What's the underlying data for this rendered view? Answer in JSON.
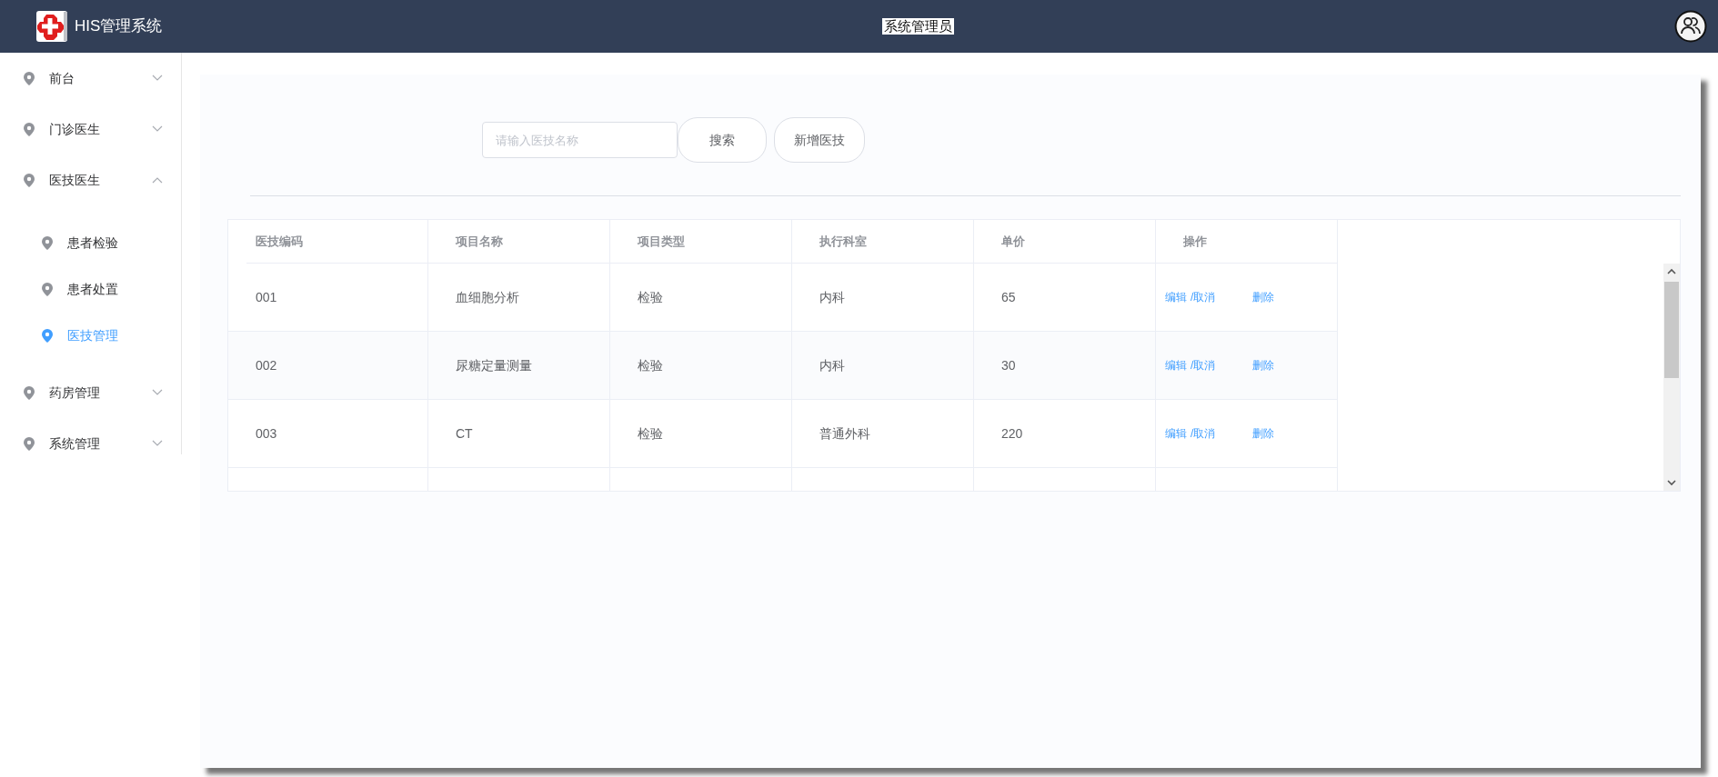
{
  "header": {
    "title": "HIS管理系统",
    "user": "系统管理员"
  },
  "sidebar": {
    "items": [
      {
        "label": "前台",
        "expanded": false
      },
      {
        "label": "门诊医生",
        "expanded": false
      },
      {
        "label": "医技医生",
        "expanded": true,
        "children": [
          {
            "label": "患者检验",
            "selected": false
          },
          {
            "label": "患者处置",
            "selected": false
          },
          {
            "label": "医技管理",
            "selected": true
          }
        ]
      },
      {
        "label": "药房管理",
        "expanded": false
      },
      {
        "label": "系统管理",
        "expanded": false
      }
    ]
  },
  "search": {
    "placeholder": "请输入医技名称"
  },
  "buttons": [
    "搜索",
    "新增医技"
  ],
  "table": {
    "columns": [
      "医技编码",
      "项目名称",
      "项目类型",
      "执行科室",
      "单价",
      "操作"
    ],
    "rows": [
      {
        "cells": [
          "001",
          "血细胞分析",
          "检验",
          "内科",
          "65"
        ],
        "actions": [
          "编辑",
          "/取消",
          "删除"
        ]
      },
      {
        "cells": [
          "002",
          "尿糖定量测量",
          "检验",
          "内科",
          "30"
        ],
        "actions": [
          "编辑",
          "/取消",
          "删除"
        ]
      },
      {
        "cells": [
          "003",
          "CT",
          "检验",
          "普通外科",
          "220"
        ],
        "actions": [
          "编辑",
          "/取消",
          "删除"
        ]
      }
    ]
  }
}
